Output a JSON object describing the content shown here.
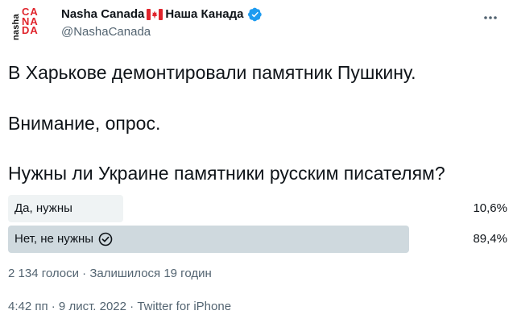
{
  "author": {
    "name_part1": "Nasha Canada",
    "name_part2": "Наша Канада",
    "handle": "@NashaCanada",
    "avatar_text_side": "nasha",
    "avatar_text_main": "CANADA",
    "flag_icon": "canada-flag-icon",
    "verified_icon": "verified-badge-icon"
  },
  "tweet": {
    "lines": [
      "В Харькове демонтировали памятник Пушкину.",
      "Внимание, опрос.",
      "Нужны ли Украине памятники русским писателям?"
    ]
  },
  "poll": {
    "options": [
      {
        "label": "Да, нужны",
        "percent_text": "10,6%",
        "fraction": 0.106,
        "selected": false
      },
      {
        "label": "Нет, не нужны",
        "percent_text": "89,4%",
        "fraction": 0.894,
        "selected": true
      }
    ],
    "summary": "2 134 голоси · Залишилося 19 годин"
  },
  "footer": {
    "timestamp": "4:42 пп · 9 лист. 2022 · Twitter for iPhone"
  },
  "colors": {
    "winner_bar": "#cfd9de",
    "loser_bar": "#eff3f4",
    "verified": "#1d9bf0",
    "flag_red": "#e0242c",
    "secondary_text": "#536471"
  }
}
